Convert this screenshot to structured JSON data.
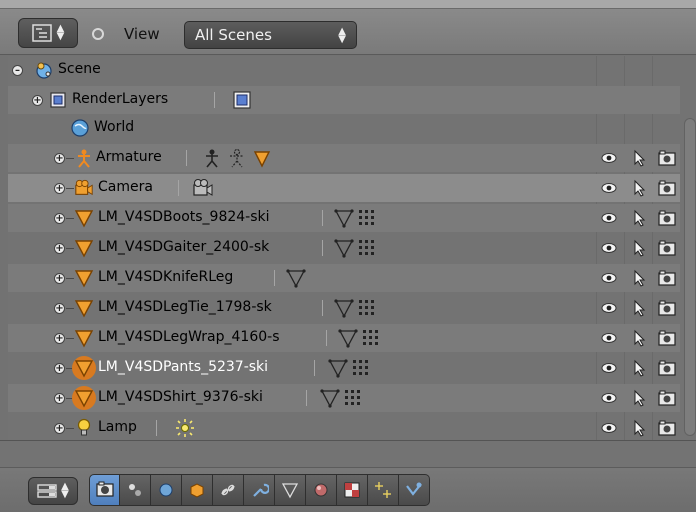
{
  "header": {
    "view_label": "View",
    "display_mode": "All Scenes"
  },
  "outliner": {
    "items": [
      {
        "label": "Scene",
        "icon": "scene-icon",
        "expanded": true
      },
      {
        "label": "RenderLayers",
        "icon": "render-layers-icon",
        "expanded": false
      },
      {
        "label": "World",
        "icon": "world-icon"
      },
      {
        "label": "Armature",
        "icon": "armature-icon",
        "expanded": false
      },
      {
        "label": "Camera",
        "icon": "camera-icon",
        "expanded": false
      },
      {
        "label": "LM_V4SDBoots_9824-ski",
        "icon": "mesh-icon",
        "expanded": false
      },
      {
        "label": "LM_V4SDGaiter_2400-sk",
        "icon": "mesh-icon",
        "expanded": false
      },
      {
        "label": "LM_V4SDKnifeRLeg",
        "icon": "mesh-icon",
        "expanded": false
      },
      {
        "label": "LM_V4SDLegTie_1798-sk",
        "icon": "mesh-icon",
        "expanded": false
      },
      {
        "label": "LM_V4SDLegWrap_4160-s",
        "icon": "mesh-icon",
        "expanded": false
      },
      {
        "label": "LM_V4SDPants_5237-ski",
        "icon": "mesh-icon",
        "expanded": false
      },
      {
        "label": "LM_V4SDShirt_9376-ski",
        "icon": "mesh-icon",
        "expanded": false
      },
      {
        "label": "Lamp",
        "icon": "lamp-icon",
        "expanded": false
      }
    ]
  },
  "colors": {
    "accent": "#5a8ccf",
    "mesh_orange": "#e8851e",
    "panel": "#737373"
  },
  "properties_tabs": [
    "render-tab",
    "render-layers-tab",
    "scene-tab",
    "world-tab",
    "object-tab",
    "constraints-tab",
    "modifiers-tab",
    "data-tab",
    "material-tab",
    "texture-tab",
    "particles-tab",
    "physics-tab"
  ]
}
